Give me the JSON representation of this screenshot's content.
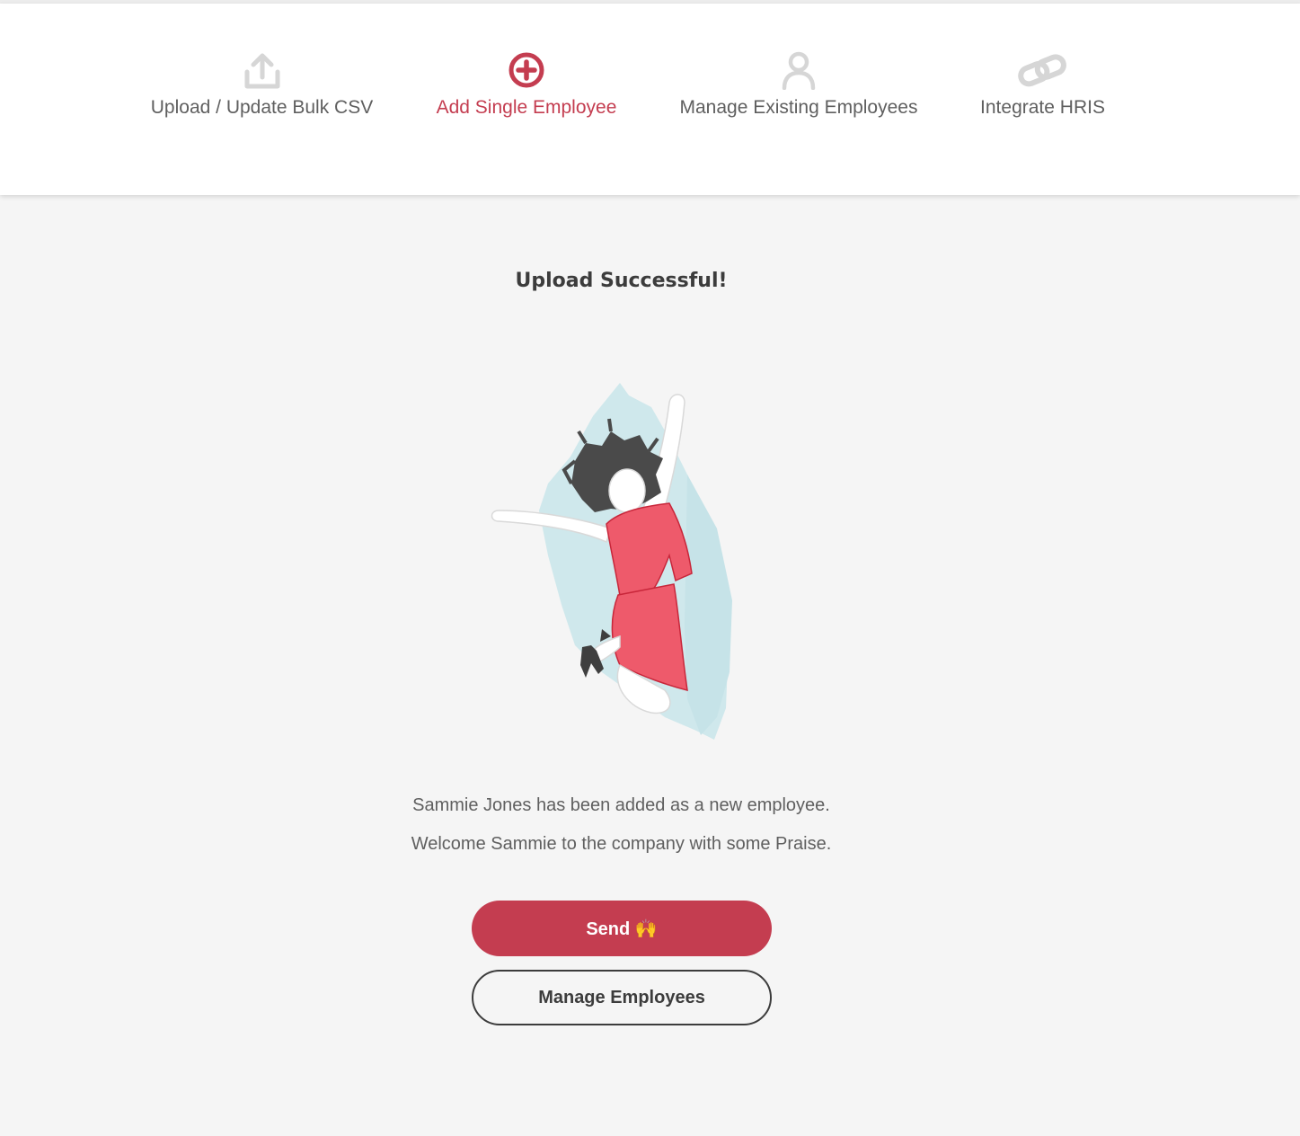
{
  "tabs": [
    {
      "label": "Upload / Update Bulk CSV",
      "icon": "upload-icon",
      "active": false
    },
    {
      "label": "Add Single Employee",
      "icon": "plus-circle-icon",
      "active": true
    },
    {
      "label": "Manage Existing Employees",
      "icon": "user-icon",
      "active": false
    },
    {
      "label": "Integrate HRIS",
      "icon": "link-icon",
      "active": false
    }
  ],
  "main": {
    "title": "Upload Successful!",
    "message_line1": "Sammie Jones has been added as a new employee.",
    "message_line2": "Welcome Sammie to the company with some Praise.",
    "send_label": "Send 🙌",
    "manage_label": "Manage Employees",
    "illustration": "celebrating-woman-illustration"
  },
  "colors": {
    "accent": "#c43d50",
    "inactive_icon": "#d6d6d6",
    "text": "#5f5f5f",
    "background": "#f5f5f5"
  }
}
